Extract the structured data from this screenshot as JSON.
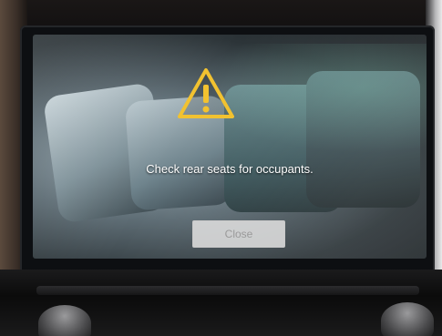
{
  "alert": {
    "message": "Check rear seats for occupants.",
    "close_label": "Close",
    "icon": "warning-triangle-icon",
    "icon_color": "#f2c230"
  }
}
